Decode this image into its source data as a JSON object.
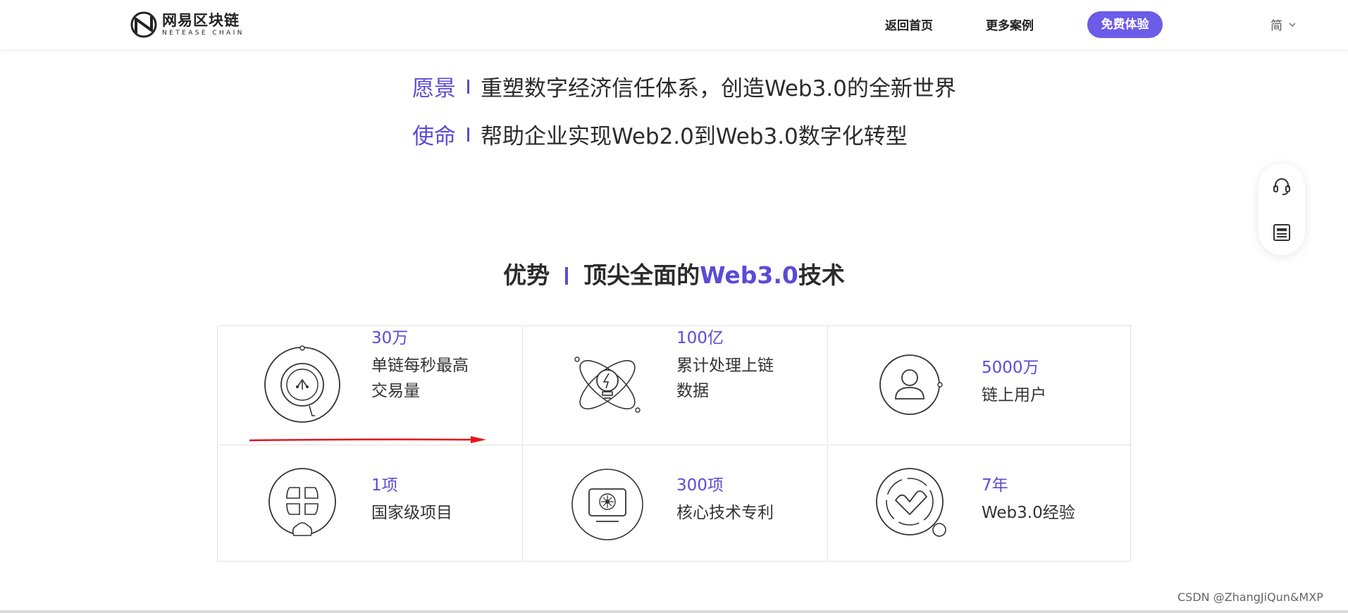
{
  "header": {
    "logo_cn": "网易区块链",
    "logo_en": "NETEASE CHAIN",
    "nav": [
      {
        "label": "返回首页"
      },
      {
        "label": "更多案例"
      }
    ],
    "trial_button": "免费体验",
    "language": "简"
  },
  "vision": {
    "label": "愿景",
    "text": "重塑数字经济信任体系，创造Web3.0的全新世界"
  },
  "mission": {
    "label": "使命",
    "text": "帮助企业实现Web2.0到Web3.0数字化转型"
  },
  "advantage": {
    "title_left": "优势",
    "title_prefix": "顶尖全面的",
    "title_highlight": "Web3.0",
    "title_suffix": "技术",
    "items": [
      {
        "value": "30万",
        "desc": "单链每秒最高\n交易量",
        "icon": "transaction-speed-icon"
      },
      {
        "value": "100亿",
        "desc": "累计处理上链\n数据",
        "icon": "data-atom-icon"
      },
      {
        "value": "5000万",
        "desc": "链上用户",
        "icon": "user-icon"
      },
      {
        "value": "1项",
        "desc": "国家级项目",
        "icon": "national-project-icon"
      },
      {
        "value": "300项",
        "desc": "核心技术专利",
        "icon": "patent-monitor-icon"
      },
      {
        "value": "7年",
        "desc": "Web3.0经验",
        "icon": "experience-check-icon"
      }
    ]
  },
  "colors": {
    "accent": "#5b4bd6",
    "button": "#6c5ce7",
    "annotation": "#e8141c"
  },
  "watermark": "CSDN @ZhangJiQun&MXP"
}
